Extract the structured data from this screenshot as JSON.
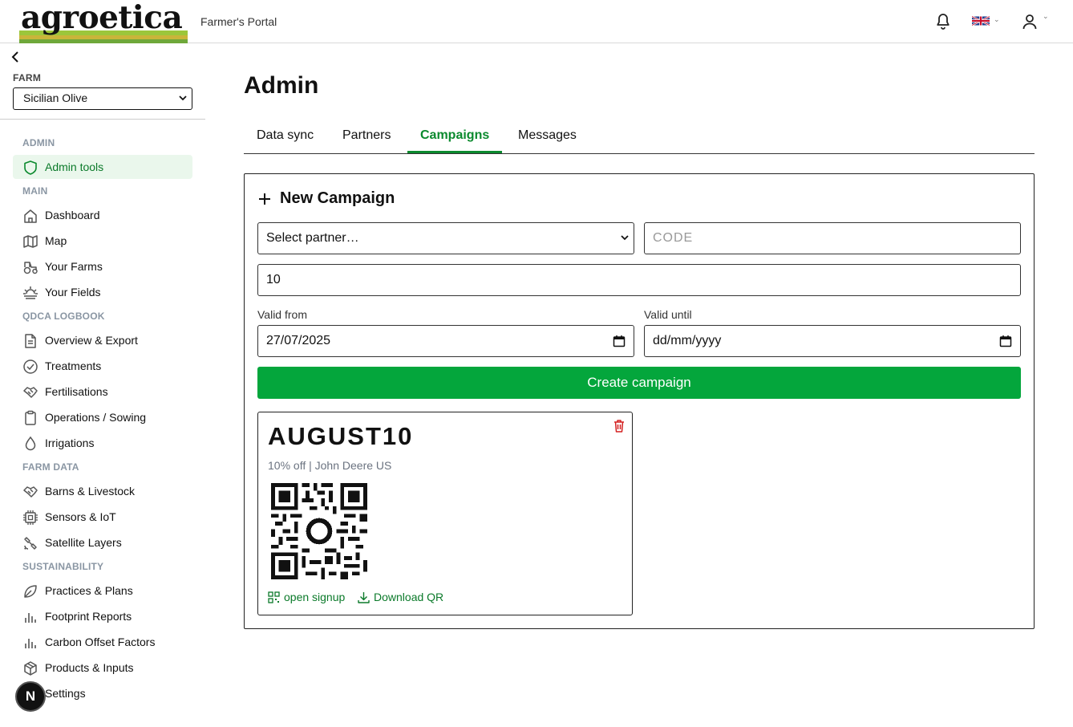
{
  "header": {
    "logo_text": "agroetica",
    "portal_title": "Farmer's Portal",
    "icons": [
      "bell-icon",
      "uk-flag-icon",
      "user-icon"
    ]
  },
  "sidebar": {
    "farm_label": "FARM",
    "farm_selected": "Sicilian Olive",
    "sections": {
      "admin": "ADMIN",
      "main": "MAIN",
      "qdca": "QDCA LOGBOOK",
      "farm_data": "FARM DATA",
      "sustainability": "SUSTAINABILITY"
    },
    "items": {
      "admin_tools": "Admin tools",
      "dashboard": "Dashboard",
      "map": "Map",
      "your_farms": "Your Farms",
      "your_fields": "Your Fields",
      "overview_export": "Overview & Export",
      "treatments": "Treatments",
      "fertilisations": "Fertilisations",
      "operations_sowing": "Operations / Sowing",
      "irrigations": "Irrigations",
      "barns_livestock": "Barns & Livestock",
      "sensors_iot": "Sensors & IoT",
      "satellite_layers": "Satellite Layers",
      "practices_plans": "Practices & Plans",
      "footprint_reports": "Footprint Reports",
      "carbon_offset": "Carbon Offset Factors",
      "products_inputs": "Products & Inputs",
      "settings": "Settings"
    },
    "badge": "N"
  },
  "main": {
    "title": "Admin",
    "tabs": [
      "Data sync",
      "Partners",
      "Campaigns",
      "Messages"
    ],
    "active_tab": "Campaigns",
    "new_campaign": {
      "title": "New Campaign",
      "partner_placeholder": "Select partner…",
      "code_placeholder": "CODE",
      "discount_value": "10",
      "valid_from_label": "Valid from",
      "valid_from_value": "27/07/2025",
      "valid_until_label": "Valid until",
      "valid_until_value": "dd/mm/yyyy",
      "create_button": "Create campaign"
    },
    "campaign_card": {
      "code": "AUGUST10",
      "details": "10% off | John Deere US",
      "open_signup": "open signup",
      "download_qr": "Download QR"
    }
  },
  "colors": {
    "accent_green": "#04a63c",
    "active_text_green": "#0b7a2a",
    "danger_red": "#d42020"
  }
}
